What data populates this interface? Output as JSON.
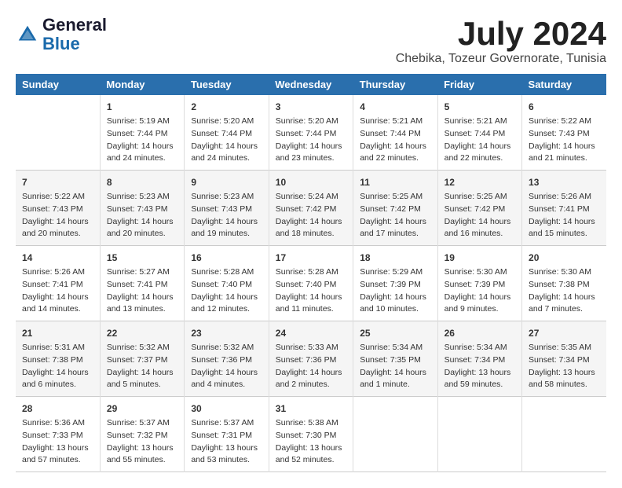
{
  "header": {
    "logo_general": "General",
    "logo_blue": "Blue",
    "month_title": "July 2024",
    "subtitle": "Chebika, Tozeur Governorate, Tunisia"
  },
  "weekdays": [
    "Sunday",
    "Monday",
    "Tuesday",
    "Wednesday",
    "Thursday",
    "Friday",
    "Saturday"
  ],
  "weeks": [
    [
      {
        "day": "",
        "info": ""
      },
      {
        "day": "1",
        "info": "Sunrise: 5:19 AM\nSunset: 7:44 PM\nDaylight: 14 hours\nand 24 minutes."
      },
      {
        "day": "2",
        "info": "Sunrise: 5:20 AM\nSunset: 7:44 PM\nDaylight: 14 hours\nand 24 minutes."
      },
      {
        "day": "3",
        "info": "Sunrise: 5:20 AM\nSunset: 7:44 PM\nDaylight: 14 hours\nand 23 minutes."
      },
      {
        "day": "4",
        "info": "Sunrise: 5:21 AM\nSunset: 7:44 PM\nDaylight: 14 hours\nand 22 minutes."
      },
      {
        "day": "5",
        "info": "Sunrise: 5:21 AM\nSunset: 7:44 PM\nDaylight: 14 hours\nand 22 minutes."
      },
      {
        "day": "6",
        "info": "Sunrise: 5:22 AM\nSunset: 7:43 PM\nDaylight: 14 hours\nand 21 minutes."
      }
    ],
    [
      {
        "day": "7",
        "info": "Sunrise: 5:22 AM\nSunset: 7:43 PM\nDaylight: 14 hours\nand 20 minutes."
      },
      {
        "day": "8",
        "info": "Sunrise: 5:23 AM\nSunset: 7:43 PM\nDaylight: 14 hours\nand 20 minutes."
      },
      {
        "day": "9",
        "info": "Sunrise: 5:23 AM\nSunset: 7:43 PM\nDaylight: 14 hours\nand 19 minutes."
      },
      {
        "day": "10",
        "info": "Sunrise: 5:24 AM\nSunset: 7:42 PM\nDaylight: 14 hours\nand 18 minutes."
      },
      {
        "day": "11",
        "info": "Sunrise: 5:25 AM\nSunset: 7:42 PM\nDaylight: 14 hours\nand 17 minutes."
      },
      {
        "day": "12",
        "info": "Sunrise: 5:25 AM\nSunset: 7:42 PM\nDaylight: 14 hours\nand 16 minutes."
      },
      {
        "day": "13",
        "info": "Sunrise: 5:26 AM\nSunset: 7:41 PM\nDaylight: 14 hours\nand 15 minutes."
      }
    ],
    [
      {
        "day": "14",
        "info": "Sunrise: 5:26 AM\nSunset: 7:41 PM\nDaylight: 14 hours\nand 14 minutes."
      },
      {
        "day": "15",
        "info": "Sunrise: 5:27 AM\nSunset: 7:41 PM\nDaylight: 14 hours\nand 13 minutes."
      },
      {
        "day": "16",
        "info": "Sunrise: 5:28 AM\nSunset: 7:40 PM\nDaylight: 14 hours\nand 12 minutes."
      },
      {
        "day": "17",
        "info": "Sunrise: 5:28 AM\nSunset: 7:40 PM\nDaylight: 14 hours\nand 11 minutes."
      },
      {
        "day": "18",
        "info": "Sunrise: 5:29 AM\nSunset: 7:39 PM\nDaylight: 14 hours\nand 10 minutes."
      },
      {
        "day": "19",
        "info": "Sunrise: 5:30 AM\nSunset: 7:39 PM\nDaylight: 14 hours\nand 9 minutes."
      },
      {
        "day": "20",
        "info": "Sunrise: 5:30 AM\nSunset: 7:38 PM\nDaylight: 14 hours\nand 7 minutes."
      }
    ],
    [
      {
        "day": "21",
        "info": "Sunrise: 5:31 AM\nSunset: 7:38 PM\nDaylight: 14 hours\nand 6 minutes."
      },
      {
        "day": "22",
        "info": "Sunrise: 5:32 AM\nSunset: 7:37 PM\nDaylight: 14 hours\nand 5 minutes."
      },
      {
        "day": "23",
        "info": "Sunrise: 5:32 AM\nSunset: 7:36 PM\nDaylight: 14 hours\nand 4 minutes."
      },
      {
        "day": "24",
        "info": "Sunrise: 5:33 AM\nSunset: 7:36 PM\nDaylight: 14 hours\nand 2 minutes."
      },
      {
        "day": "25",
        "info": "Sunrise: 5:34 AM\nSunset: 7:35 PM\nDaylight: 14 hours\nand 1 minute."
      },
      {
        "day": "26",
        "info": "Sunrise: 5:34 AM\nSunset: 7:34 PM\nDaylight: 13 hours\nand 59 minutes."
      },
      {
        "day": "27",
        "info": "Sunrise: 5:35 AM\nSunset: 7:34 PM\nDaylight: 13 hours\nand 58 minutes."
      }
    ],
    [
      {
        "day": "28",
        "info": "Sunrise: 5:36 AM\nSunset: 7:33 PM\nDaylight: 13 hours\nand 57 minutes."
      },
      {
        "day": "29",
        "info": "Sunrise: 5:37 AM\nSunset: 7:32 PM\nDaylight: 13 hours\nand 55 minutes."
      },
      {
        "day": "30",
        "info": "Sunrise: 5:37 AM\nSunset: 7:31 PM\nDaylight: 13 hours\nand 53 minutes."
      },
      {
        "day": "31",
        "info": "Sunrise: 5:38 AM\nSunset: 7:30 PM\nDaylight: 13 hours\nand 52 minutes."
      },
      {
        "day": "",
        "info": ""
      },
      {
        "day": "",
        "info": ""
      },
      {
        "day": "",
        "info": ""
      }
    ]
  ]
}
